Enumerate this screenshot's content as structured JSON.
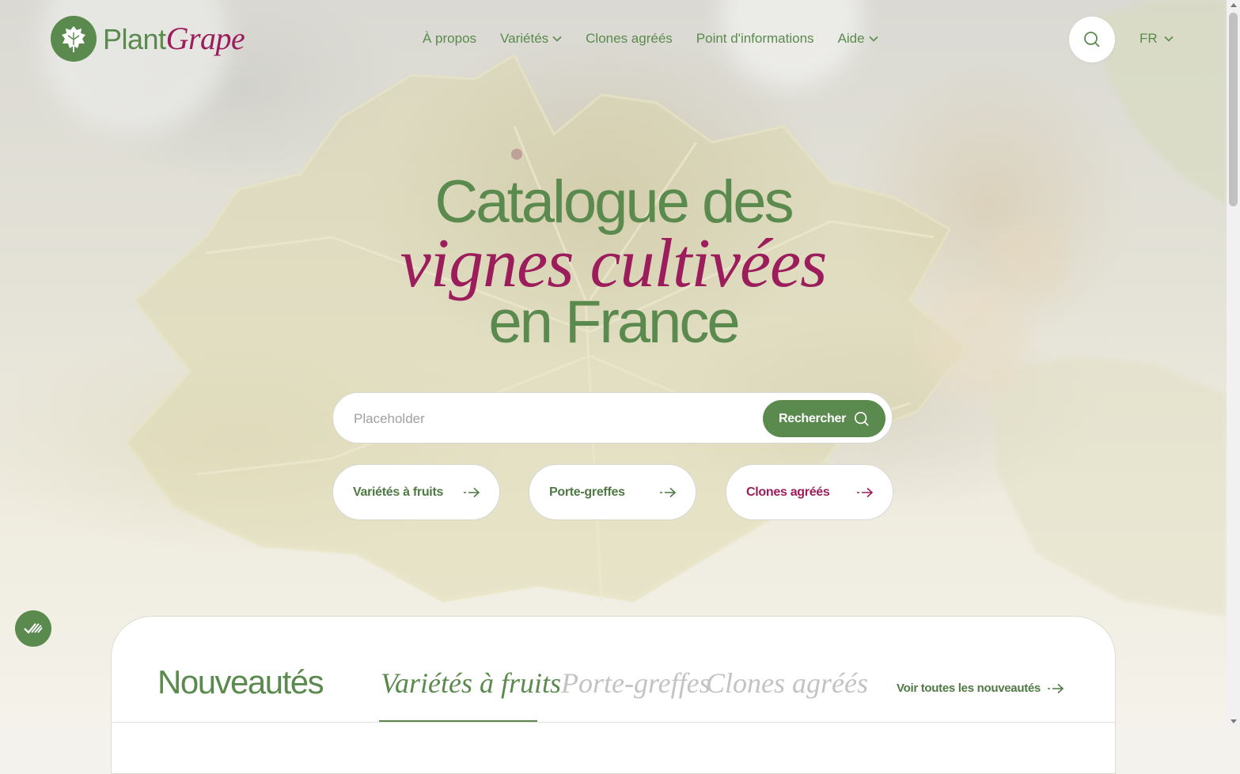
{
  "brand": {
    "name_part1": "Plant",
    "name_part2": "Grape"
  },
  "nav": {
    "items": [
      {
        "label": "À propos",
        "has_dropdown": false
      },
      {
        "label": "Variétés",
        "has_dropdown": true
      },
      {
        "label": "Clones agréés",
        "has_dropdown": false
      },
      {
        "label": "Point d'informations",
        "has_dropdown": false
      },
      {
        "label": "Aide",
        "has_dropdown": true
      }
    ],
    "language": "FR"
  },
  "hero": {
    "line1": "Catalogue des",
    "line2": "vignes cultivées",
    "line3": "en France"
  },
  "search": {
    "placeholder": "Placeholder",
    "value": "",
    "button_label": "Rechercher"
  },
  "categories": [
    {
      "label": "Variétés à fruits",
      "color": "#4f7a43"
    },
    {
      "label": "Porte-greffes",
      "color": "#4f7a43"
    },
    {
      "label": "Clones agréés",
      "color": "#9c1d5c"
    }
  ],
  "news": {
    "title": "Nouveautés",
    "tabs": [
      {
        "label": "Variétés à fruits",
        "active": true
      },
      {
        "label": "Porte-greffes",
        "active": false
      },
      {
        "label": "Clones agréés",
        "active": false
      }
    ],
    "see_all": "Voir toutes les nouveautés"
  },
  "colors": {
    "green": "#5a8a4d",
    "purple": "#9c1d5c",
    "muted": "#c3c3c1"
  },
  "icons": {
    "logo": "grape-leaf-icon",
    "search": "search-icon",
    "dropdown": "chevron-down-icon",
    "arrow": "arrow-right-icon",
    "accessibility": "accessibility-icon"
  }
}
